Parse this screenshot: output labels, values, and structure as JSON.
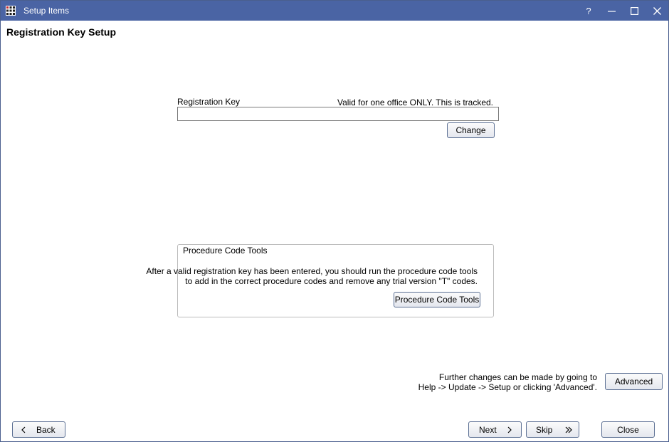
{
  "window": {
    "title": "Setup Items",
    "help_glyph": "?",
    "title_bar_color": "#4a64a4"
  },
  "page_title": "Registration Key Setup",
  "registration": {
    "label": "Registration Key",
    "note": "Valid for one office ONLY.  This is tracked.",
    "value": "",
    "placeholder": "",
    "change_label": "Change"
  },
  "procedure_tools": {
    "group_label": "Procedure Code Tools",
    "line1": "After a valid registration key has been entered, you should run the procedure code tools",
    "line2": "to add in the correct procedure codes and remove any trial version \"T\" codes.",
    "button_label": "Procedure Code Tools"
  },
  "advanced": {
    "line1": "Further changes can be made by going to",
    "line2": "Help -> Update -> Setup or clicking 'Advanced'.",
    "button_label": "Advanced"
  },
  "footer": {
    "back_label": "Back",
    "next_label": "Next",
    "skip_label": "Skip",
    "close_label": "Close"
  },
  "icons": {
    "app": "grid-app-icon",
    "back": "chevron-left-icon",
    "next": "chevron-right-icon",
    "skip": "double-chevron-right-icon"
  }
}
